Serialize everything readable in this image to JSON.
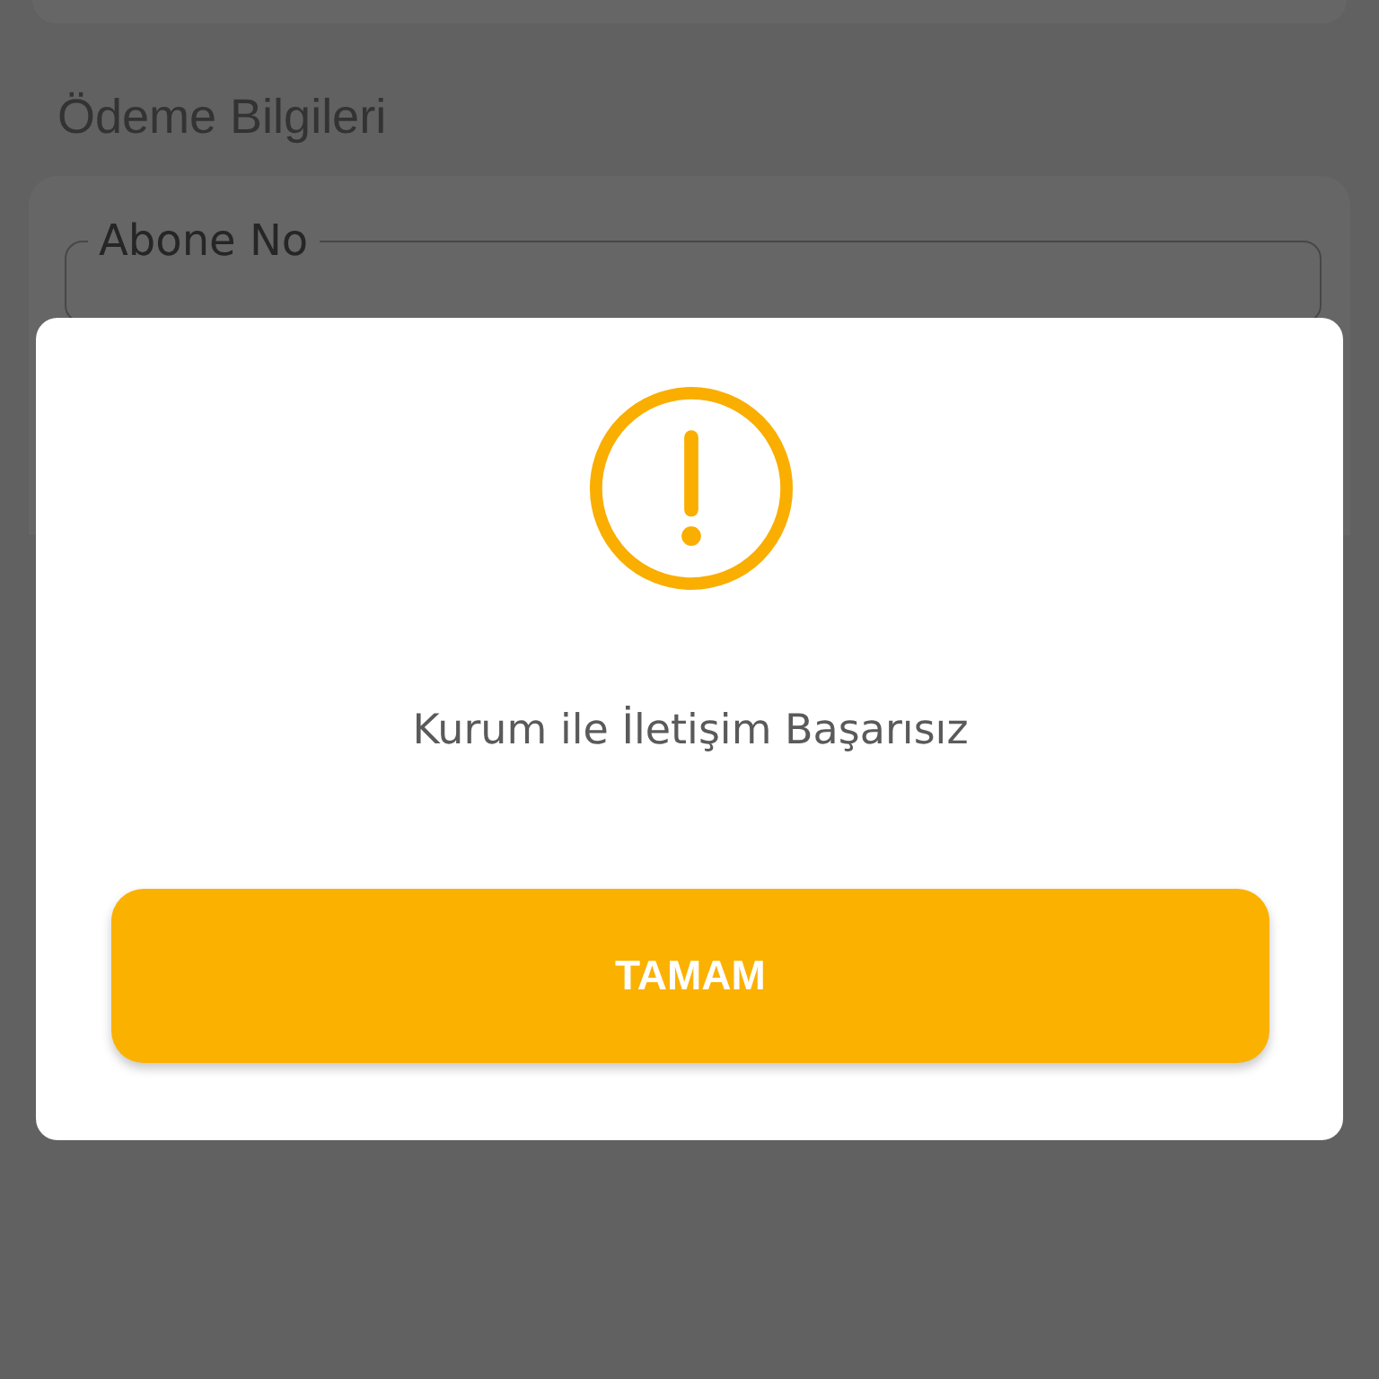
{
  "page": {
    "section_title": "Ödeme Bilgileri",
    "fields": [
      {
        "label": "Abone No"
      }
    ]
  },
  "dialog": {
    "kind": "warning",
    "message": "Kurum ile İletişim Başarısız",
    "buttons": [
      {
        "label": "TAMAM"
      }
    ]
  }
}
